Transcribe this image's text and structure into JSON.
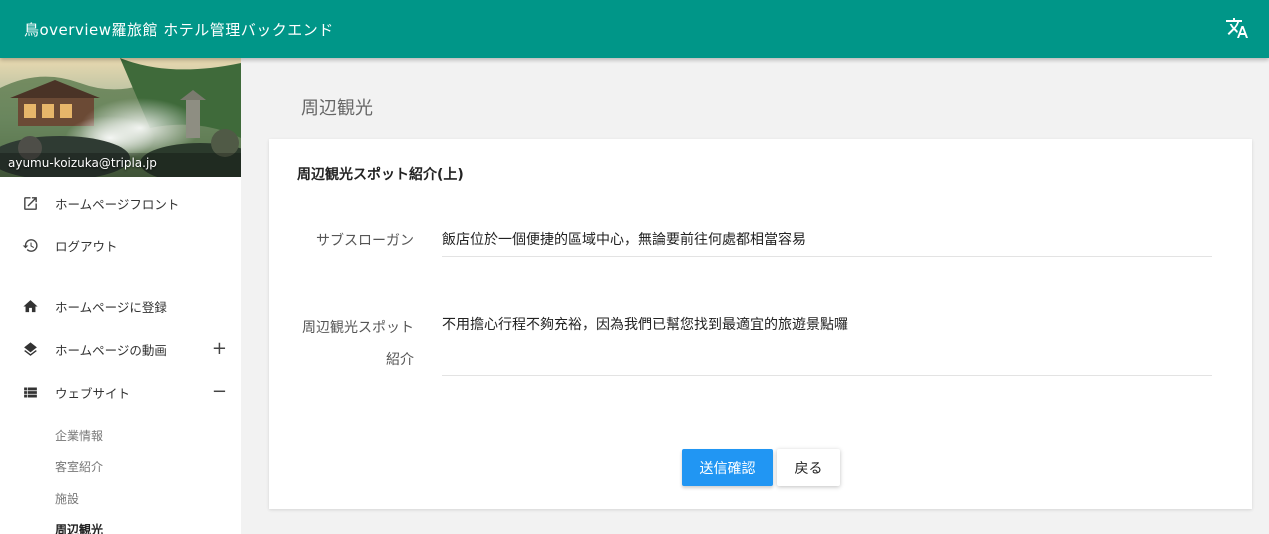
{
  "app": {
    "title": "鳥overview羅旅館 ホテル管理バックエンド",
    "translate_icon": "translate-icon"
  },
  "sidebar": {
    "email": "ayumu-koizuka@tripla.jp",
    "items": [
      {
        "label": "ホームページフロント",
        "icon": "open-in-new-icon"
      },
      {
        "label": "ログアウト",
        "icon": "history-icon"
      },
      {
        "label": "ホームページに登録",
        "icon": "home-icon"
      },
      {
        "label": "ホームページの動画",
        "icon": "layers-icon",
        "toggle": "+"
      },
      {
        "label": "ウェブサイト",
        "icon": "list-icon",
        "toggle": "−"
      }
    ],
    "subitems": [
      {
        "label": "企業情報"
      },
      {
        "label": "客室紹介"
      },
      {
        "label": "施設"
      },
      {
        "label": "周辺観光"
      }
    ]
  },
  "main": {
    "page_title": "周辺観光",
    "card_title": "周辺観光スポット紹介(上)",
    "fields": [
      {
        "label": "サブスローガン",
        "value": "飯店位於一個便捷的區域中心，無論要前往何處都相當容易"
      },
      {
        "label_line1": "周辺観光スポット",
        "label_line2": "紹介",
        "value": "不用擔心行程不夠充裕，因為我們已幫您找到最適宜的旅遊景點囉"
      }
    ],
    "submit_label": "送信確認",
    "back_label": "戻る"
  },
  "colors": {
    "header": "#009688",
    "primary_button": "#2196f3"
  }
}
